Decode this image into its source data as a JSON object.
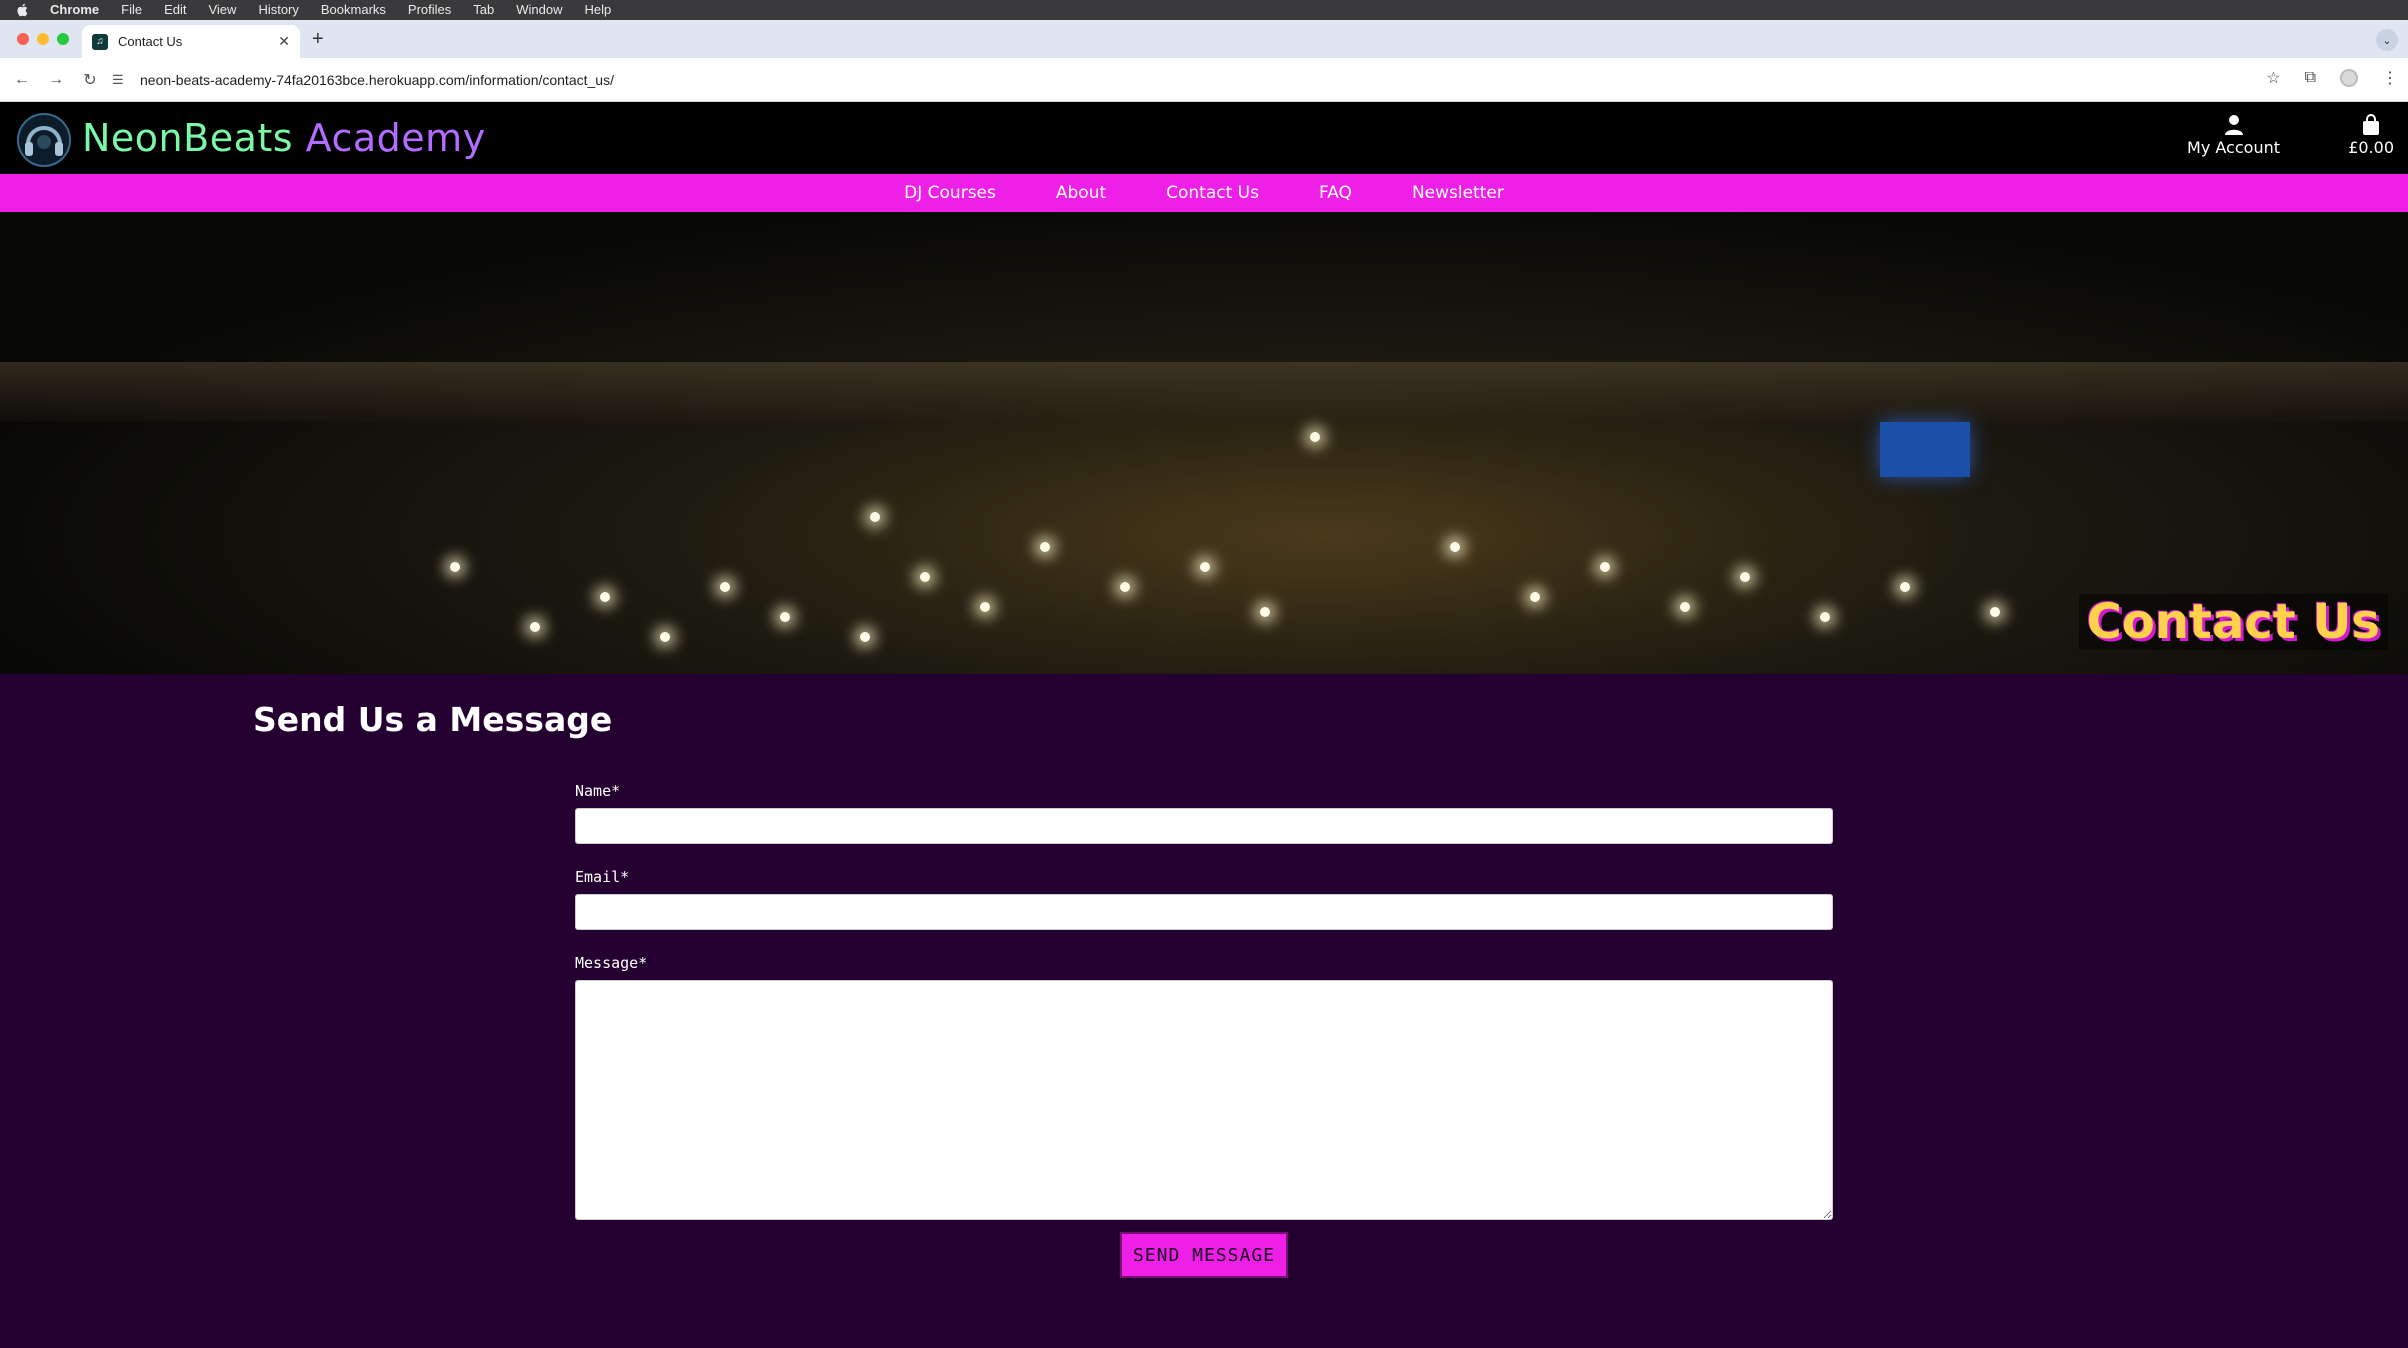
{
  "os_menubar": {
    "app": "Chrome",
    "items": [
      "File",
      "Edit",
      "View",
      "History",
      "Bookmarks",
      "Profiles",
      "Tab",
      "Window",
      "Help"
    ]
  },
  "browser": {
    "tab_title": "Contact Us",
    "url": "neon-beats-academy-74fa20163bce.herokuapp.com/information/contact_us/"
  },
  "site": {
    "brand_part1": "NeonBeats",
    "brand_part2": "Academy",
    "account_label": "My Account",
    "cart_total": "£0.00",
    "nav": [
      "DJ Courses",
      "About",
      "Contact Us",
      "FAQ",
      "Newsletter"
    ],
    "hero_title": "Contact Us"
  },
  "form": {
    "heading": "Send Us a Message",
    "name_label": "Name*",
    "email_label": "Email*",
    "message_label": "Message*",
    "name_value": "",
    "email_value": "",
    "message_value": "",
    "submit_label": "SEND MESSAGE"
  },
  "colors": {
    "nav_bar": "#ee1fe6",
    "page_bg": "#230030",
    "brand_green": "#7cf7a8",
    "brand_purple": "#b26cff",
    "hero_title": "#ffd24a"
  }
}
